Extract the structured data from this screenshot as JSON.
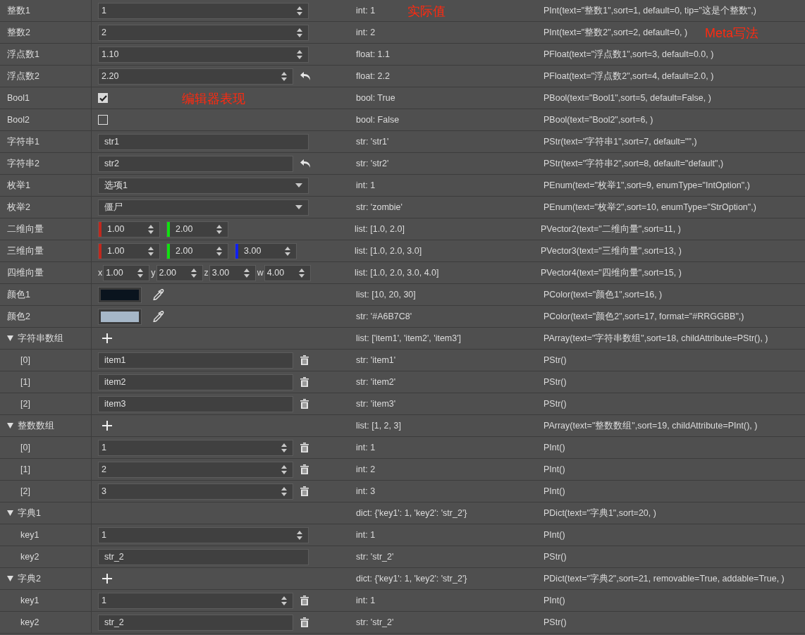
{
  "rows": [
    {
      "label": "整数1",
      "kind": "int",
      "value": "1",
      "revert": false,
      "actual": "int: 1",
      "meta": "PInt(text=\"整数1\",sort=1, default=0, tip=\"这是个整数\",)",
      "actual_note": "实际值"
    },
    {
      "label": "整数2",
      "kind": "int",
      "value": "2",
      "revert": false,
      "actual": "int: 2",
      "meta": "PInt(text=\"整数2\",sort=2, default=0, )",
      "meta_note": "Meta写法"
    },
    {
      "label": "浮点数1",
      "kind": "float",
      "value": "1.10",
      "revert": false,
      "actual": "float: 1.1",
      "meta": "PFloat(text=\"浮点数1\",sort=3, default=0.0, )"
    },
    {
      "label": "浮点数2",
      "kind": "float",
      "value": "2.20",
      "revert": true,
      "actual": "float: 2.2",
      "meta": "PFloat(text=\"浮点数2\",sort=4, default=2.0, )"
    },
    {
      "label": "Bool1",
      "kind": "bool",
      "checked": true,
      "revert": false,
      "actual": "bool: True",
      "meta": "PBool(text=\"Bool1\",sort=5, default=False, )",
      "editor_note": "编辑器表现"
    },
    {
      "label": "Bool2",
      "kind": "bool",
      "checked": false,
      "revert": false,
      "actual": "bool: False",
      "meta": "PBool(text=\"Bool2\",sort=6, )"
    },
    {
      "label": "字符串1",
      "kind": "str",
      "value": "str1",
      "revert": false,
      "actual": "str: 'str1'",
      "meta": "PStr(text=\"字符串1\",sort=7, default=\"\",)"
    },
    {
      "label": "字符串2",
      "kind": "str",
      "value": "str2",
      "revert": true,
      "actual": "str: 'str2'",
      "meta": "PStr(text=\"字符串2\",sort=8, default=\"default\",)"
    },
    {
      "label": "枚举1",
      "kind": "enum",
      "value": "选项1",
      "revert": false,
      "actual": "int: 1",
      "meta": "PEnum(text=\"枚举1\",sort=9, enumType=\"IntOption\",)"
    },
    {
      "label": "枚举2",
      "kind": "enum",
      "value": "僵尸",
      "revert": false,
      "actual": "str: 'zombie'",
      "meta": "PEnum(text=\"枚举2\",sort=10, enumType=\"StrOption\",)"
    },
    {
      "label": "二维向量",
      "kind": "vector",
      "components": [
        {
          "color": "#c0281e",
          "value": "1.00"
        },
        {
          "color": "#10e010",
          "value": "2.00"
        }
      ],
      "revert": false,
      "actual": "list: [1.0, 2.0]",
      "meta": "PVector2(text=\"二维向量\",sort=11, )"
    },
    {
      "label": "三维向量",
      "kind": "vector",
      "components": [
        {
          "color": "#c0281e",
          "value": "1.00"
        },
        {
          "color": "#10e010",
          "value": "2.00"
        },
        {
          "color": "#1020f0",
          "value": "3.00"
        }
      ],
      "revert": false,
      "actual": "list: [1.0, 2.0, 3.0]",
      "meta": "PVector3(text=\"三维向量\",sort=13, )"
    },
    {
      "label": "四维向量",
      "kind": "vector",
      "components": [
        {
          "prefix": "x",
          "value": "1.00"
        },
        {
          "prefix": "y",
          "value": "2.00"
        },
        {
          "prefix": "z",
          "value": "3.00"
        },
        {
          "prefix": "w",
          "value": "4.00"
        }
      ],
      "revert": false,
      "actual": "list: [1.0, 2.0, 3.0, 4.0]",
      "meta": "PVector4(text=\"四维向量\",sort=15, )"
    },
    {
      "label": "颜色1",
      "kind": "color",
      "color": "#0a141e",
      "revert": false,
      "actual": "list: [10, 20, 30]",
      "meta": "PColor(text=\"颜色1\",sort=16, )"
    },
    {
      "label": "颜色2",
      "kind": "color",
      "color": "#a6b7c8",
      "revert": false,
      "actual": "str: '#A6B7C8'",
      "meta": "PColor(text=\"颜色2\",sort=17, format=\"#RRGGBB\",)"
    },
    {
      "label": "字符串数组",
      "kind": "group",
      "expanded": true,
      "addable": true,
      "actual": "list: ['item1', 'item2', 'item3']",
      "meta": "PArray(text=\"字符串数组\",sort=18, childAttribute=PStr(), )",
      "children": [
        {
          "label": "[0]",
          "kind": "str",
          "value": "item1",
          "removable": true,
          "actual": "str: 'item1'",
          "meta": "PStr()"
        },
        {
          "label": "[1]",
          "kind": "str",
          "value": "item2",
          "removable": true,
          "actual": "str: 'item2'",
          "meta": "PStr()"
        },
        {
          "label": "[2]",
          "kind": "str",
          "value": "item3",
          "removable": true,
          "actual": "str: 'item3'",
          "meta": "PStr()"
        }
      ]
    },
    {
      "label": "整数数组",
      "kind": "group",
      "expanded": true,
      "addable": true,
      "actual": "list: [1, 2, 3]",
      "meta": "PArray(text=\"整数数组\",sort=19, childAttribute=PInt(), )",
      "children": [
        {
          "label": "[0]",
          "kind": "int",
          "value": "1",
          "removable": true,
          "actual": "int: 1",
          "meta": "PInt()"
        },
        {
          "label": "[1]",
          "kind": "int",
          "value": "2",
          "removable": true,
          "actual": "int: 2",
          "meta": "PInt()"
        },
        {
          "label": "[2]",
          "kind": "int",
          "value": "3",
          "removable": true,
          "actual": "int: 3",
          "meta": "PInt()"
        }
      ]
    },
    {
      "label": "字典1",
      "kind": "group",
      "expanded": true,
      "addable": false,
      "actual": "dict: {'key1': 1, 'key2': 'str_2'}",
      "meta": "PDict(text=\"字典1\",sort=20, )",
      "children": [
        {
          "label": "key1",
          "kind": "int",
          "value": "1",
          "removable": false,
          "actual": "int: 1",
          "meta": "PInt()"
        },
        {
          "label": "key2",
          "kind": "str",
          "value": "str_2",
          "removable": false,
          "actual": "str: 'str_2'",
          "meta": "PStr()"
        }
      ]
    },
    {
      "label": "字典2",
      "kind": "group",
      "expanded": true,
      "addable": true,
      "actual": "dict: {'key1': 1, 'key2': 'str_2'}",
      "meta": "PDict(text=\"字典2\",sort=21, removable=True, addable=True, )",
      "children": [
        {
          "label": "key1",
          "kind": "int",
          "value": "1",
          "removable": true,
          "actual": "int: 1",
          "meta": "PInt()"
        },
        {
          "label": "key2",
          "kind": "str",
          "value": "str_2",
          "removable": true,
          "actual": "str: 'str_2'",
          "meta": "PStr()"
        }
      ]
    }
  ]
}
